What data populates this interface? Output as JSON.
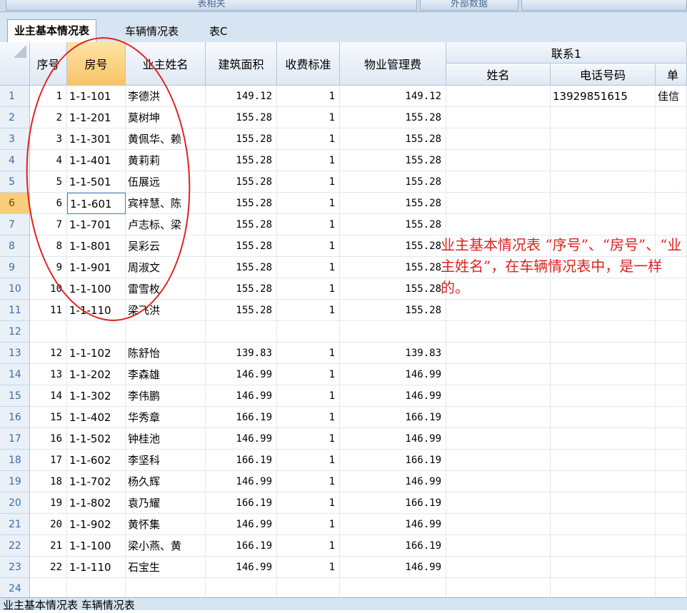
{
  "top_buttons": [
    "表相关",
    "外部数据",
    ""
  ],
  "tabs": [
    "业主基本情况表",
    "车辆情况表",
    "表C"
  ],
  "active_tab": 0,
  "columns": {
    "seq": "序号",
    "room": "房号",
    "owner": "业主姓名",
    "area": "建筑面积",
    "rate": "收费标准",
    "fee": "物业管理费",
    "contact_group": "联系1",
    "contact_name": "姓名",
    "contact_phone": "电话号码",
    "contact_unit": "单"
  },
  "selected_row": 6,
  "active_cell": {
    "row": 6,
    "column": "room"
  },
  "rows": [
    {
      "n": "1",
      "seq": "1",
      "room": "1-1-101",
      "owner": "李德洪",
      "area": "149.12",
      "rate": "1",
      "fee": "149.12",
      "cname": "",
      "phone": "13929851615",
      "unit": "佳信"
    },
    {
      "n": "2",
      "seq": "2",
      "room": "1-1-201",
      "owner": "莫树坤",
      "area": "155.28",
      "rate": "1",
      "fee": "155.28",
      "cname": "",
      "phone": "",
      "unit": ""
    },
    {
      "n": "3",
      "seq": "3",
      "room": "1-1-301",
      "owner": "黄佩华、赖",
      "area": "155.28",
      "rate": "1",
      "fee": "155.28",
      "cname": "",
      "phone": "",
      "unit": ""
    },
    {
      "n": "4",
      "seq": "4",
      "room": "1-1-401",
      "owner": "黄莉莉",
      "area": "155.28",
      "rate": "1",
      "fee": "155.28",
      "cname": "",
      "phone": "",
      "unit": ""
    },
    {
      "n": "5",
      "seq": "5",
      "room": "1-1-501",
      "owner": "伍展远",
      "area": "155.28",
      "rate": "1",
      "fee": "155.28",
      "cname": "",
      "phone": "",
      "unit": ""
    },
    {
      "n": "6",
      "seq": "6",
      "room": "1-1-601",
      "owner": "宾梓慧、陈",
      "area": "155.28",
      "rate": "1",
      "fee": "155.28",
      "cname": "",
      "phone": "",
      "unit": ""
    },
    {
      "n": "7",
      "seq": "7",
      "room": "1-1-701",
      "owner": "卢志标、梁",
      "area": "155.28",
      "rate": "1",
      "fee": "155.28",
      "cname": "",
      "phone": "",
      "unit": ""
    },
    {
      "n": "8",
      "seq": "8",
      "room": "1-1-801",
      "owner": "吴彩云",
      "area": "155.28",
      "rate": "1",
      "fee": "155.28",
      "cname": "",
      "phone": "",
      "unit": ""
    },
    {
      "n": "9",
      "seq": "9",
      "room": "1-1-901",
      "owner": "周淑文",
      "area": "155.28",
      "rate": "1",
      "fee": "155.28",
      "cname": "",
      "phone": "",
      "unit": ""
    },
    {
      "n": "10",
      "seq": "10",
      "room": "1-1-100",
      "owner": "雷雪枚",
      "area": "155.28",
      "rate": "1",
      "fee": "155.28",
      "cname": "",
      "phone": "",
      "unit": ""
    },
    {
      "n": "11",
      "seq": "11",
      "room": "1-1-110",
      "owner": "梁飞洪",
      "area": "155.28",
      "rate": "1",
      "fee": "155.28",
      "cname": "",
      "phone": "",
      "unit": ""
    },
    {
      "n": "12",
      "seq": "",
      "room": "",
      "owner": "",
      "area": "",
      "rate": "",
      "fee": "",
      "cname": "",
      "phone": "",
      "unit": ""
    },
    {
      "n": "13",
      "seq": "12",
      "room": "1-1-102",
      "owner": "陈舒怡",
      "area": "139.83",
      "rate": "1",
      "fee": "139.83",
      "cname": "",
      "phone": "",
      "unit": ""
    },
    {
      "n": "14",
      "seq": "13",
      "room": "1-1-202",
      "owner": "李森雄",
      "area": "146.99",
      "rate": "1",
      "fee": "146.99",
      "cname": "",
      "phone": "",
      "unit": ""
    },
    {
      "n": "15",
      "seq": "14",
      "room": "1-1-302",
      "owner": "李伟鹏",
      "area": "146.99",
      "rate": "1",
      "fee": "146.99",
      "cname": "",
      "phone": "",
      "unit": ""
    },
    {
      "n": "16",
      "seq": "15",
      "room": "1-1-402",
      "owner": "华秀章",
      "area": "166.19",
      "rate": "1",
      "fee": "166.19",
      "cname": "",
      "phone": "",
      "unit": ""
    },
    {
      "n": "17",
      "seq": "16",
      "room": "1-1-502",
      "owner": "钟桂池",
      "area": "146.99",
      "rate": "1",
      "fee": "146.99",
      "cname": "",
      "phone": "",
      "unit": ""
    },
    {
      "n": "18",
      "seq": "17",
      "room": "1-1-602",
      "owner": "李坚科",
      "area": "166.19",
      "rate": "1",
      "fee": "166.19",
      "cname": "",
      "phone": "",
      "unit": ""
    },
    {
      "n": "19",
      "seq": "18",
      "room": "1-1-702",
      "owner": "杨久辉",
      "area": "146.99",
      "rate": "1",
      "fee": "146.99",
      "cname": "",
      "phone": "",
      "unit": ""
    },
    {
      "n": "20",
      "seq": "19",
      "room": "1-1-802",
      "owner": "袁乃耀",
      "area": "166.19",
      "rate": "1",
      "fee": "166.19",
      "cname": "",
      "phone": "",
      "unit": ""
    },
    {
      "n": "21",
      "seq": "20",
      "room": "1-1-902",
      "owner": "黄怀集",
      "area": "146.99",
      "rate": "1",
      "fee": "146.99",
      "cname": "",
      "phone": "",
      "unit": ""
    },
    {
      "n": "22",
      "seq": "21",
      "room": "1-1-100",
      "owner": "梁小燕、黄",
      "area": "166.19",
      "rate": "1",
      "fee": "166.19",
      "cname": "",
      "phone": "",
      "unit": ""
    },
    {
      "n": "23",
      "seq": "22",
      "room": "1-1-110",
      "owner": "石宝生",
      "area": "146.99",
      "rate": "1",
      "fee": "146.99",
      "cname": "",
      "phone": "",
      "unit": ""
    },
    {
      "n": "24",
      "seq": "",
      "room": "",
      "owner": "",
      "area": "",
      "rate": "",
      "fee": "",
      "cname": "",
      "phone": "",
      "unit": ""
    }
  ],
  "annotation": "业主基本情况表 “序号”、“房号”、“业主姓名”，在车辆情况表中，是一样的。",
  "bottom_tabs": "业主基本情况表 车辆情况表"
}
